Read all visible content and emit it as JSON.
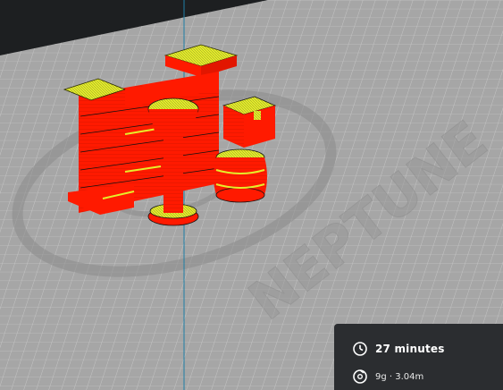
{
  "viewport": {
    "bed_logo_text": "NEPTUNE",
    "colors": {
      "bed": "#a8a8a8",
      "grid": "#c6c6c6",
      "background": "#1d1f21",
      "axis_line": "#1e7fa6",
      "model_wall": "#ff1a00",
      "model_top": "#e6ee2a",
      "panel": "#2b2d30"
    },
    "objects": [
      {
        "name": "fireplace-wall",
        "icon": "layer-preview"
      },
      {
        "name": "pillar-column",
        "icon": "layer-preview"
      },
      {
        "name": "small-crate",
        "icon": "layer-preview"
      },
      {
        "name": "barrel",
        "icon": "layer-preview"
      }
    ]
  },
  "print_info": {
    "time_icon": "clock-icon",
    "time": "27 minutes",
    "material_icon": "spool-icon",
    "material": "9g · 3.04m"
  }
}
